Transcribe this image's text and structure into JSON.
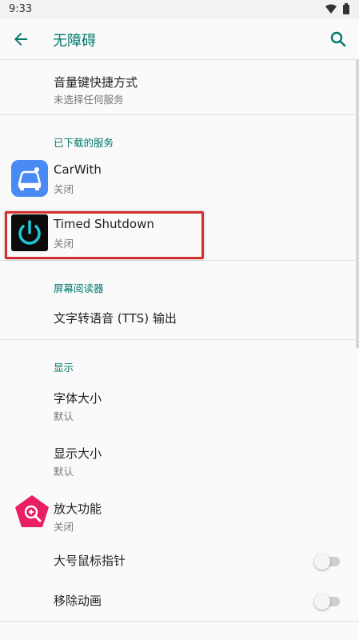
{
  "status_bar": {
    "time": "9:33"
  },
  "app_bar": {
    "title": "无障碍"
  },
  "items": {
    "volume_shortcut": {
      "title": "音量键快捷方式",
      "subtitle": "未选择任何服务"
    },
    "downloaded_section": "已下载的服务",
    "carwith": {
      "title": "CarWith",
      "subtitle": "关闭"
    },
    "timed_shutdown": {
      "title": "Timed Shutdown",
      "subtitle": "关闭"
    },
    "screen_reader_section": "屏幕阅读器",
    "tts": {
      "title": "文字转语音 (TTS) 输出"
    },
    "display_section": "显示",
    "font_size": {
      "title": "字体大小",
      "subtitle": "默认"
    },
    "display_size": {
      "title": "显示大小",
      "subtitle": "默认"
    },
    "magnification": {
      "title": "放大功能",
      "subtitle": "关闭"
    },
    "large_pointer": {
      "title": "大号鼠标指针",
      "enabled": false
    },
    "remove_animations": {
      "title": "移除动画",
      "enabled": false
    }
  },
  "colors": {
    "accent": "#00796b",
    "highlight": "#d32f2f",
    "carwith_icon": "#4285f4",
    "magnify_icon": "#e91e63",
    "shutdown_ring": "#1ec8d8"
  },
  "icons": [
    "back-arrow-icon",
    "search-icon",
    "wifi-icon",
    "battery-icon",
    "carwith-app-icon",
    "power-icon",
    "magnifier-icon"
  ]
}
